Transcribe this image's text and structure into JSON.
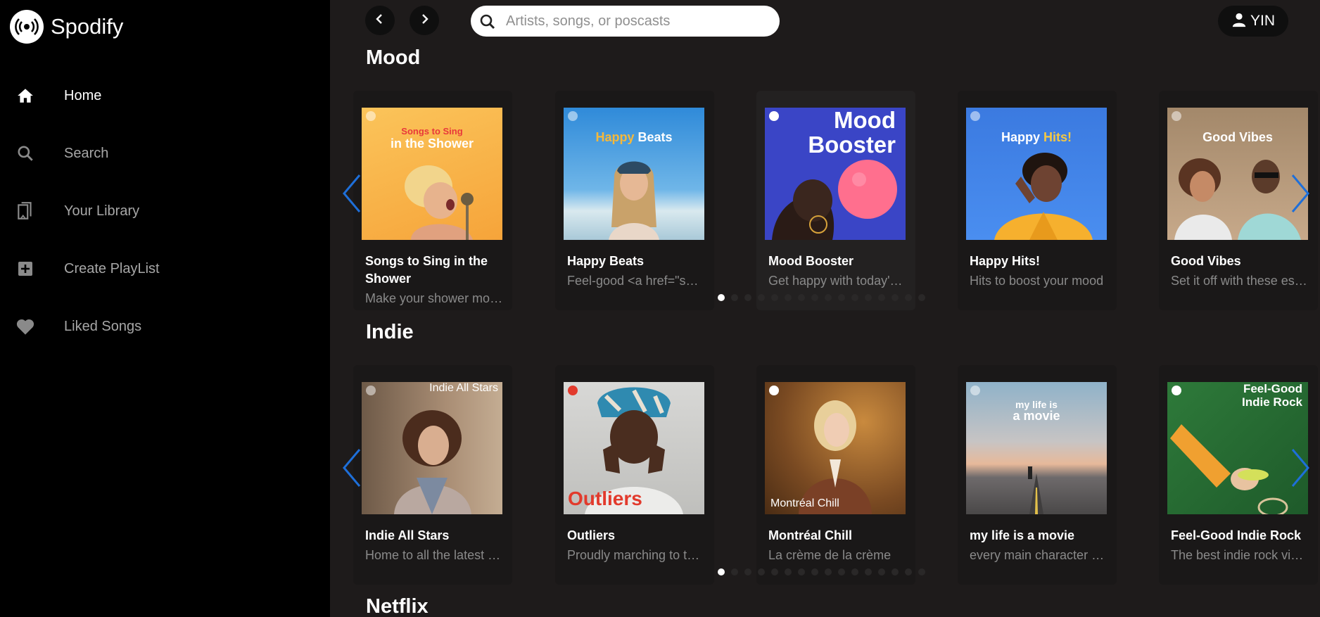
{
  "app": {
    "name": "Spodify"
  },
  "nav": [
    {
      "label": "Home",
      "icon": "home-icon"
    },
    {
      "label": "Search",
      "icon": "search-icon"
    },
    {
      "label": "Your Library",
      "icon": "library-icon"
    },
    {
      "label": "Create PlayList",
      "icon": "plus-square-icon"
    },
    {
      "label": "Liked Songs",
      "icon": "heart-icon"
    }
  ],
  "search": {
    "placeholder": "Artists, songs, or poscasts"
  },
  "user": {
    "name": "YIN"
  },
  "sections": [
    {
      "title": "Mood",
      "cards": [
        {
          "title": "Songs to Sing in the Shower",
          "desc": "Make your shower more fun",
          "cover_line1": "Songs to Sing",
          "cover_line2": "in the Shower"
        },
        {
          "title": "Happy Beats",
          "desc": "Feel-good <a href=\"spotify",
          "cover_a": "Happy",
          "cover_b": "Beats"
        },
        {
          "title": "Mood Booster",
          "desc": "Get happy with today's dose",
          "cover_line1": "Mood",
          "cover_line2": "Booster"
        },
        {
          "title": "Happy Hits!",
          "desc": "Hits to boost your mood",
          "cover_a": "Happy",
          "cover_b": "Hits!"
        },
        {
          "title": "Good Vibes",
          "desc": "Set it off with these essentials",
          "cover_line1": "Good Vibes"
        }
      ],
      "dots_total": 16,
      "active_dot": 1
    },
    {
      "title": "Indie",
      "cards": [
        {
          "title": "Indie All Stars",
          "desc": "Home to all the latest indie",
          "cover_line1": "Indie All Stars"
        },
        {
          "title": "Outliers",
          "desc": "Proudly marching to their own",
          "cover_line1": "Outliers"
        },
        {
          "title": "Montréal Chill",
          "desc": "La crème de la crème",
          "cover_line1": "Montréal Chill"
        },
        {
          "title": "my life is a movie",
          "desc": "every main character needs",
          "cover_line1": "my life is",
          "cover_line2": "a movie"
        },
        {
          "title": "Feel-Good Indie Rock",
          "desc": "The best indie rock vibes",
          "cover_line1": "Feel-Good",
          "cover_line2": "Indie Rock"
        }
      ],
      "dots_total": 16,
      "active_dot": 1
    },
    {
      "title": "Netflix"
    }
  ],
  "colors": {
    "accent_arrow": "#1e6fd9",
    "sidebar_bg": "#000000",
    "main_bg": "#1e1b1b"
  }
}
